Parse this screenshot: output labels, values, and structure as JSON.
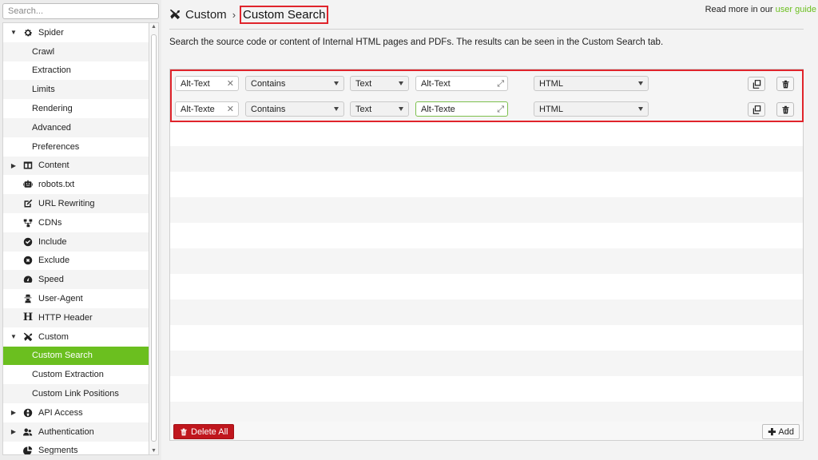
{
  "search": {
    "placeholder": "Search..."
  },
  "sidebar": {
    "items": [
      {
        "label": "Spider",
        "icon": "gear-icon",
        "expanded": true
      },
      {
        "label": "Crawl"
      },
      {
        "label": "Extraction"
      },
      {
        "label": "Limits"
      },
      {
        "label": "Rendering"
      },
      {
        "label": "Advanced"
      },
      {
        "label": "Preferences"
      },
      {
        "label": "Content",
        "icon": "layout-icon",
        "expanded": false
      },
      {
        "label": "robots.txt",
        "icon": "robot-icon"
      },
      {
        "label": "URL Rewriting",
        "icon": "edit-icon"
      },
      {
        "label": "CDNs",
        "icon": "network-icon"
      },
      {
        "label": "Include",
        "icon": "check-circle-icon"
      },
      {
        "label": "Exclude",
        "icon": "x-circle-icon"
      },
      {
        "label": "Speed",
        "icon": "speedometer-icon"
      },
      {
        "label": "User-Agent",
        "icon": "user-secret-icon"
      },
      {
        "label": "HTTP Header",
        "icon": "header-icon"
      },
      {
        "label": "Custom",
        "icon": "tools-icon",
        "expanded": true
      },
      {
        "label": "Custom Search",
        "active": true
      },
      {
        "label": "Custom Extraction"
      },
      {
        "label": "Custom Link Positions"
      },
      {
        "label": "API Access",
        "icon": "globe-icon",
        "expanded": false
      },
      {
        "label": "Authentication",
        "icon": "users-icon",
        "expanded": false
      },
      {
        "label": "Segments",
        "icon": "pie-icon"
      }
    ]
  },
  "header": {
    "parent": "Custom",
    "separator": "›",
    "current": "Custom Search",
    "read_more_prefix": "Read more in our ",
    "read_more_link": "user guide"
  },
  "description": "Search the source code or content of Internal HTML pages and PDFs. The results can be seen in the Custom Search tab.",
  "rows": [
    {
      "name": "Alt-Text",
      "operator": "Contains",
      "mode": "Text",
      "value": "Alt-Text",
      "scope": "HTML"
    },
    {
      "name": "Alt-Texte",
      "operator": "Contains",
      "mode": "Text",
      "value": "Alt-Texte",
      "scope": "HTML"
    }
  ],
  "buttons": {
    "delete_all": "Delete All",
    "add": "Add"
  },
  "colors": {
    "accent": "#6bbf1f",
    "danger": "#c0161d",
    "highlight": "#e0242b"
  }
}
